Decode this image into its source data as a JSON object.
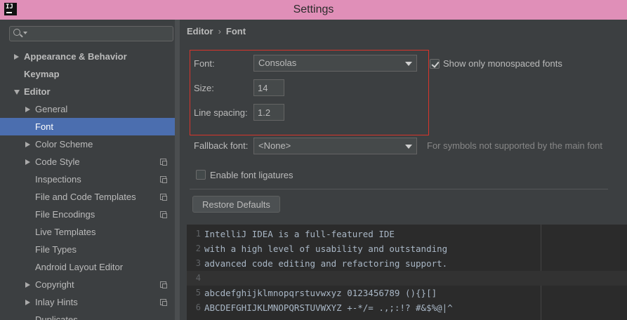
{
  "window": {
    "title": "Settings",
    "app_icon": "IJ"
  },
  "search": {
    "value": "",
    "placeholder": ""
  },
  "sidebar": {
    "items": [
      {
        "label": "Appearance & Behavior",
        "level": 0,
        "arrow": "right",
        "bold": true
      },
      {
        "label": "Keymap",
        "level": 0,
        "arrow": "",
        "bold": true
      },
      {
        "label": "Editor",
        "level": 0,
        "arrow": "down",
        "bold": true
      },
      {
        "label": "General",
        "level": 1,
        "arrow": "right"
      },
      {
        "label": "Font",
        "level": 1,
        "arrow": "",
        "selected": true
      },
      {
        "label": "Color Scheme",
        "level": 1,
        "arrow": "right"
      },
      {
        "label": "Code Style",
        "level": 1,
        "arrow": "right",
        "copy_icon": true
      },
      {
        "label": "Inspections",
        "level": 1,
        "arrow": "",
        "copy_icon": true
      },
      {
        "label": "File and Code Templates",
        "level": 1,
        "arrow": "",
        "copy_icon": true
      },
      {
        "label": "File Encodings",
        "level": 1,
        "arrow": "",
        "copy_icon": true
      },
      {
        "label": "Live Templates",
        "level": 1,
        "arrow": ""
      },
      {
        "label": "File Types",
        "level": 1,
        "arrow": ""
      },
      {
        "label": "Android Layout Editor",
        "level": 1,
        "arrow": ""
      },
      {
        "label": "Copyright",
        "level": 1,
        "arrow": "right",
        "copy_icon": true
      },
      {
        "label": "Inlay Hints",
        "level": 1,
        "arrow": "right",
        "copy_icon": true
      },
      {
        "label": "Duplicates",
        "level": 1,
        "arrow": ""
      }
    ]
  },
  "breadcrumb": {
    "parent": "Editor",
    "separator": "›",
    "current": "Font"
  },
  "font_settings": {
    "font_label": "Font:",
    "font_value": "Consolas",
    "show_mono_label": "Show only monospaced fonts",
    "show_mono_checked": true,
    "size_label": "Size:",
    "size_value": "14",
    "line_spacing_label": "Line spacing:",
    "line_spacing_value": "1.2",
    "fallback_label": "Fallback font:",
    "fallback_value": "<None>",
    "fallback_hint": "For symbols not supported by the main font",
    "ligatures_label": "Enable font ligatures",
    "ligatures_checked": false,
    "restore_label": "Restore Defaults"
  },
  "preview": {
    "lines": [
      {
        "num": "1",
        "text": "IntelliJ IDEA is a full-featured IDE"
      },
      {
        "num": "2",
        "text": "with a high level of usability and outstanding"
      },
      {
        "num": "3",
        "text": "advanced code editing and refactoring support."
      },
      {
        "num": "4",
        "text": ""
      },
      {
        "num": "5",
        "text": "abcdefghijklmnopqrstuvwxyz 0123456789 (){}[]"
      },
      {
        "num": "6",
        "text": "ABCDEFGHIJKLMNOPQRSTUVWXYZ +-*/= .,;:!? #&$%@|^"
      }
    ]
  },
  "colors": {
    "titlebar": "#e08fb8",
    "panel": "#3c3f41",
    "selection": "#4b6eaf",
    "highlight_box": "#d9342b",
    "editor_bg": "#2b2b2b"
  }
}
